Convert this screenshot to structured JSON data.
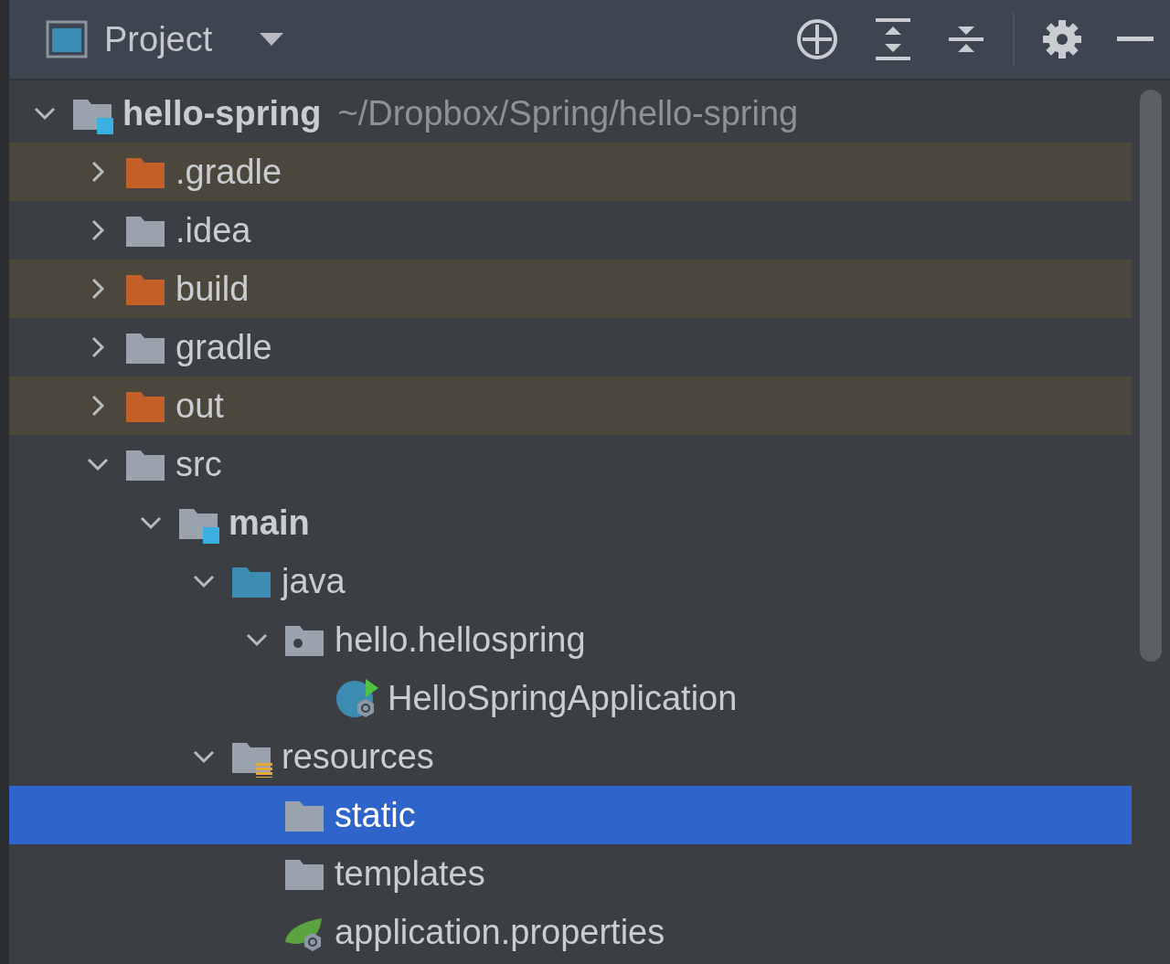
{
  "panel": {
    "title": "Project"
  },
  "tree": [
    {
      "name": "hello-spring",
      "path": "~/Dropbox/Spring/hello-spring",
      "kind": "module",
      "expanded": true,
      "selected": false,
      "children": [
        {
          "name": ".gradle",
          "kind": "excluded",
          "expanded": false,
          "selected": false
        },
        {
          "name": ".idea",
          "kind": "folder",
          "expanded": false,
          "selected": false
        },
        {
          "name": "build",
          "kind": "excluded",
          "expanded": false,
          "selected": false
        },
        {
          "name": "gradle",
          "kind": "folder",
          "expanded": false,
          "selected": false
        },
        {
          "name": "out",
          "kind": "excluded",
          "expanded": false,
          "selected": false
        },
        {
          "name": "src",
          "kind": "folder",
          "expanded": true,
          "selected": false,
          "children": [
            {
              "name": "main",
              "kind": "module",
              "expanded": true,
              "selected": false,
              "children": [
                {
                  "name": "java",
                  "kind": "source",
                  "expanded": true,
                  "selected": false,
                  "children": [
                    {
                      "name": "hello.hellospring",
                      "kind": "package",
                      "expanded": true,
                      "selected": false,
                      "children": [
                        {
                          "name": "HelloSpringApplication",
                          "kind": "spring-class",
                          "selected": false
                        }
                      ]
                    }
                  ]
                },
                {
                  "name": "resources",
                  "kind": "resources",
                  "expanded": true,
                  "selected": false,
                  "children": [
                    {
                      "name": "static",
                      "kind": "folder",
                      "selected": true
                    },
                    {
                      "name": "templates",
                      "kind": "folder",
                      "selected": false
                    },
                    {
                      "name": "application.properties",
                      "kind": "properties",
                      "selected": false
                    }
                  ]
                }
              ]
            }
          ]
        }
      ]
    }
  ]
}
